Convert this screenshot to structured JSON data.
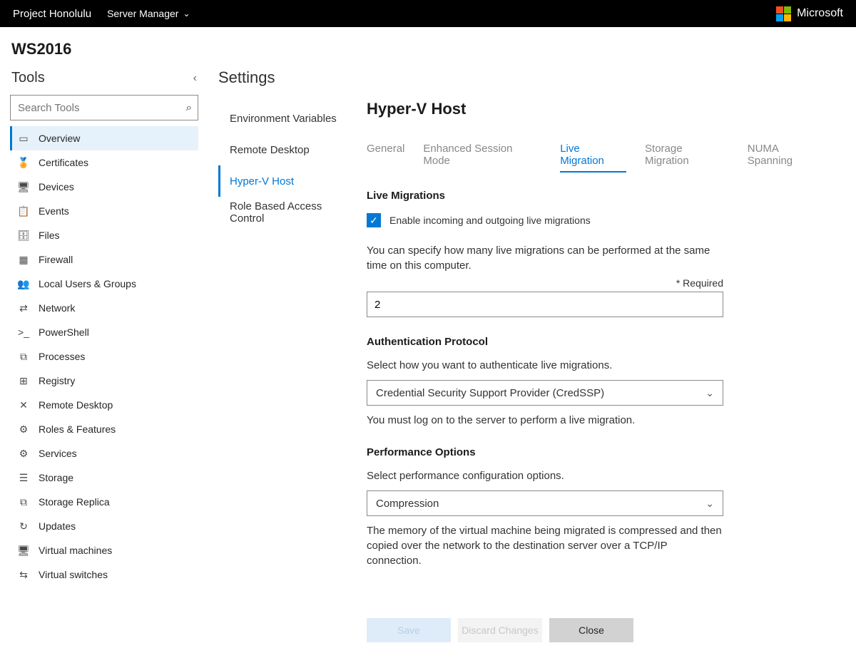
{
  "topbar": {
    "product": "Project Honolulu",
    "menu": "Server Manager",
    "brand": "Microsoft"
  },
  "server_name": "WS2016",
  "tools": {
    "title": "Tools",
    "search_placeholder": "Search Tools",
    "items": [
      {
        "label": "Overview",
        "icon": "▭",
        "active": true
      },
      {
        "label": "Certificates",
        "icon": "🏅"
      },
      {
        "label": "Devices",
        "icon": "🖥"
      },
      {
        "label": "Events",
        "icon": "📋"
      },
      {
        "label": "Files",
        "icon": "🗄"
      },
      {
        "label": "Firewall",
        "icon": "▦"
      },
      {
        "label": "Local Users & Groups",
        "icon": "👥"
      },
      {
        "label": "Network",
        "icon": "⇄"
      },
      {
        "label": "PowerShell",
        "icon": ">_"
      },
      {
        "label": "Processes",
        "icon": "⧉"
      },
      {
        "label": "Registry",
        "icon": "⊞"
      },
      {
        "label": "Remote Desktop",
        "icon": "✕"
      },
      {
        "label": "Roles & Features",
        "icon": "⚙"
      },
      {
        "label": "Services",
        "icon": "⚙"
      },
      {
        "label": "Storage",
        "icon": "☰"
      },
      {
        "label": "Storage Replica",
        "icon": "⧉"
      },
      {
        "label": "Updates",
        "icon": "↻"
      },
      {
        "label": "Virtual machines",
        "icon": "🖥"
      },
      {
        "label": "Virtual switches",
        "icon": "⇆"
      }
    ]
  },
  "settings": {
    "title": "Settings",
    "items": [
      {
        "label": "Environment Variables"
      },
      {
        "label": "Remote Desktop"
      },
      {
        "label": "Hyper-V Host",
        "active": true
      },
      {
        "label": "Role Based Access Control"
      }
    ]
  },
  "content": {
    "heading": "Hyper-V Host",
    "tabs": [
      {
        "label": "General"
      },
      {
        "label": "Enhanced Session Mode"
      },
      {
        "label": "Live Migration",
        "active": true
      },
      {
        "label": "Storage Migration"
      },
      {
        "label": "NUMA Spanning"
      }
    ],
    "section1_title": "Live Migrations",
    "enable_label": "Enable incoming and outgoing live migrations",
    "enable_checked": true,
    "concurrent_help": "You can specify how many live migrations can be performed at the same time on this computer.",
    "required_label": "* Required",
    "concurrent_value": "2",
    "auth_title": "Authentication Protocol",
    "auth_help": "Select how you want to authenticate live migrations.",
    "auth_selected": "Credential Security Support Provider (CredSSP)",
    "auth_note": "You must log on to the server to perform a live migration.",
    "perf_title": "Performance Options",
    "perf_help": "Select performance configuration options.",
    "perf_selected": "Compression",
    "perf_note": "The memory of the virtual machine being migrated is compressed and then copied over the network to the destination server over a TCP/IP connection."
  },
  "buttons": {
    "save": "Save",
    "discard": "Discard Changes",
    "close": "Close"
  }
}
